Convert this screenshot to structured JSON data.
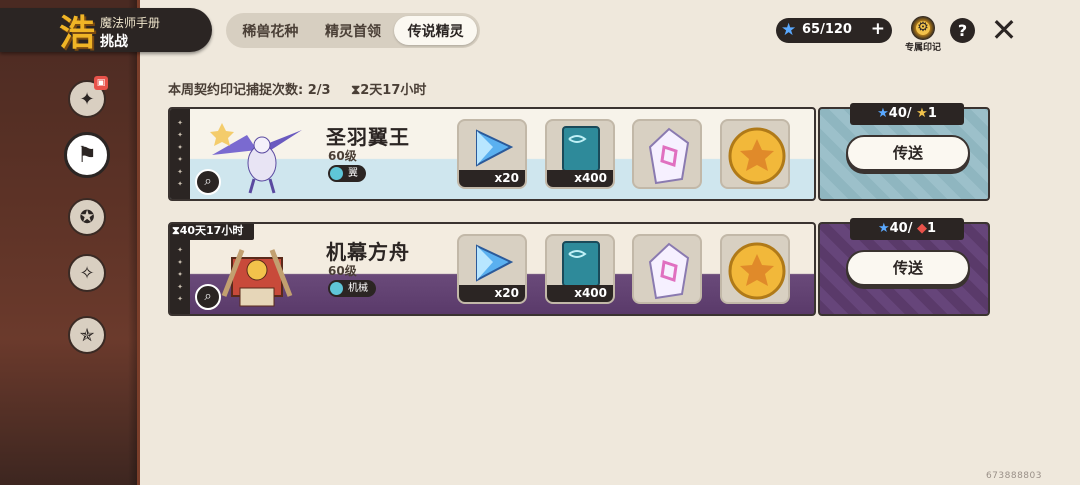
{
  "brand": {
    "logo": "浩",
    "subtitle": "魔法师手册",
    "title": "挑战"
  },
  "tabs": [
    {
      "label": "稀兽花种",
      "active": false
    },
    {
      "label": "精灵首领",
      "active": false
    },
    {
      "label": "传说精灵",
      "active": true
    }
  ],
  "energy": {
    "value": "65/120",
    "plus": "+"
  },
  "seal_button": {
    "label": "专属印记"
  },
  "help_button": {
    "label": "?"
  },
  "close_button": {
    "label": "✕"
  },
  "info": {
    "capture_count": "本周契约印记捕捉次数: 2/3",
    "countdown": "⧗2天17小时"
  },
  "cards": [
    {
      "name": "圣羽翼王",
      "level": "60级",
      "attribute": "翼",
      "timer": "",
      "rewards": [
        {
          "qty": "x20",
          "icon": "crystal-icon"
        },
        {
          "qty": "x400",
          "icon": "book-icon"
        },
        {
          "qty": "",
          "icon": "seal-card-icon"
        },
        {
          "qty": "",
          "icon": "medal-icon"
        }
      ],
      "cost": {
        "a": "40",
        "b": "1"
      },
      "button": "传送"
    },
    {
      "name": "机幕方舟",
      "level": "60级",
      "attribute": "机械",
      "timer": "⧗40天17小时",
      "rewards": [
        {
          "qty": "x20",
          "icon": "crystal-icon"
        },
        {
          "qty": "x400",
          "icon": "book-icon"
        },
        {
          "qty": "",
          "icon": "seal-card-icon"
        },
        {
          "qty": "",
          "icon": "medal-icon"
        }
      ],
      "cost": {
        "a": "40",
        "b": "1"
      },
      "button": "传送"
    }
  ],
  "uid": "673888803",
  "colors": {
    "panel": "#efe8dc",
    "dark": "#2b2523",
    "accent": "#f0b526"
  }
}
